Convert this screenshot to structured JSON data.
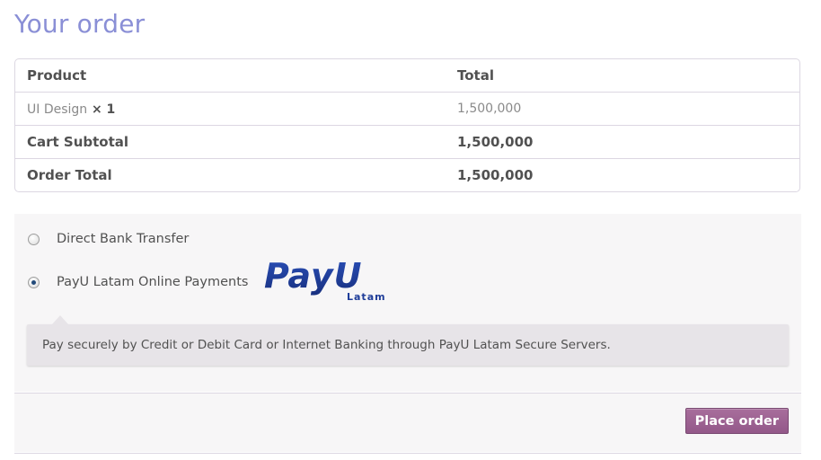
{
  "heading": "Your order",
  "table": {
    "headers": [
      "Product",
      "Total"
    ],
    "item": {
      "name": "UI Design",
      "qty": "× 1",
      "total": "1,500,000"
    },
    "subtotal": {
      "label": "Cart Subtotal",
      "value": "1,500,000"
    },
    "order_total": {
      "label": "Order Total",
      "value": "1,500,000"
    }
  },
  "payment": {
    "methods": [
      {
        "label": "Direct Bank Transfer",
        "checked": false
      },
      {
        "label": "PayU Latam Online Payments",
        "checked": true
      }
    ],
    "logo": {
      "text": "PayU",
      "subtext": "Latam",
      "color": "#1f3d99"
    },
    "description": "Pay securely by Credit or Debit Card or Internet Banking through PayU Latam Secure Servers."
  },
  "place_order": {
    "label": "Place order",
    "color": "#a46497"
  }
}
